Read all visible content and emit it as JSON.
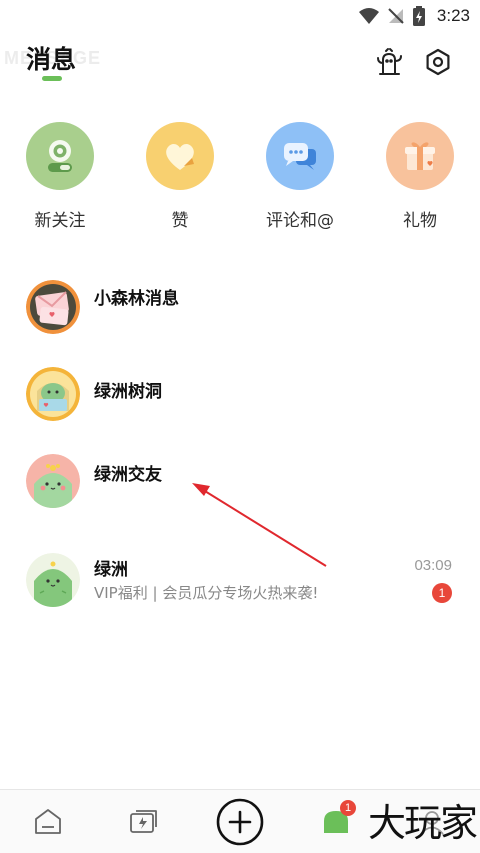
{
  "status_bar": {
    "time": "3:23"
  },
  "header": {
    "title": "消息",
    "watermark": "MESSAGE"
  },
  "quick_actions": [
    {
      "label": "新关注",
      "icon": "new-follow-icon"
    },
    {
      "label": "赞",
      "icon": "heart-icon"
    },
    {
      "label": "评论和@",
      "icon": "comment-icon"
    },
    {
      "label": "礼物",
      "icon": "gift-icon"
    }
  ],
  "messages": [
    {
      "name": "小森林消息",
      "preview": "",
      "time": "",
      "badge": ""
    },
    {
      "name": "绿洲树洞",
      "preview": "",
      "time": "",
      "badge": ""
    },
    {
      "name": "绿洲交友",
      "preview": "",
      "time": "",
      "badge": ""
    },
    {
      "name": "绿洲",
      "preview": "VIP福利 | 会员瓜分专场火热来袭!",
      "time": "03:09",
      "badge": "1"
    }
  ],
  "bottom_nav": {
    "message_badge": "1",
    "brand_watermark": "大玩家"
  },
  "colors": {
    "accent": "#6bbf59",
    "badge": "#e8473a",
    "annotation": "#e0282e"
  }
}
